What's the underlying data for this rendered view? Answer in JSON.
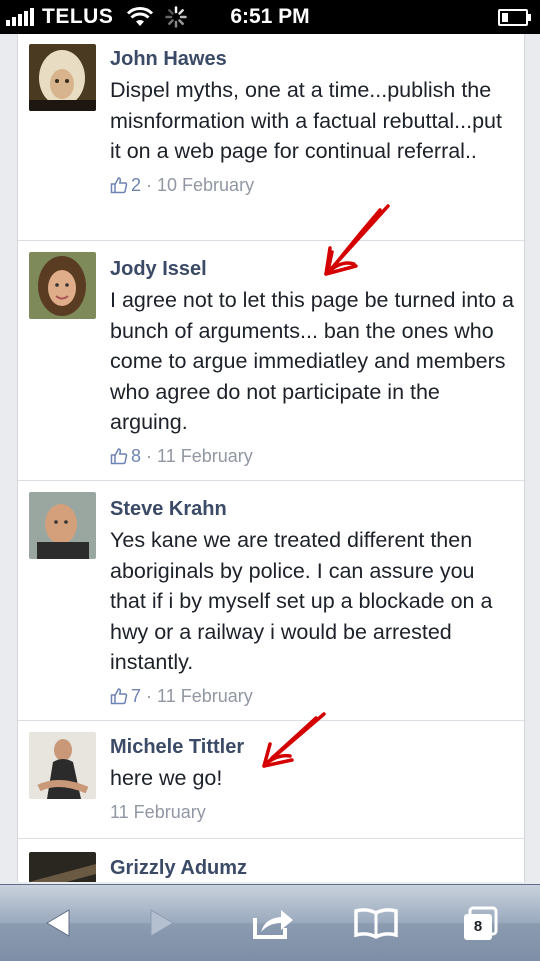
{
  "status_bar": {
    "carrier": "TELUS",
    "time": "6:51 PM"
  },
  "comments": [
    {
      "name": "John Hawes",
      "text": "Dispel myths, one at a time...publish the misnformation with a factual rebuttal...put it on a web page for continual referral..",
      "likes": "2",
      "date": "10 February"
    },
    {
      "name": "Jody Issel",
      "text": "I agree not to let this page be turned into a bunch of arguments... ban the ones who come to argue immediatley and members who agree do not participate in the arguing.",
      "likes": "8",
      "date": "11 February"
    },
    {
      "name": "Steve Krahn",
      "text": "Yes kane we are treated different then aboriginals by police. I can assure you that if i by myself set up a blockade on a hwy or a railway i would be arrested instantly.",
      "likes": "7",
      "date": "11 February"
    },
    {
      "name": "Michele Tittler",
      "text": "here we go!",
      "date": "11 February"
    },
    {
      "name": "Grizzly Adumz"
    }
  ],
  "meta_separator": "·",
  "toolbar": {
    "tabs_count": "8"
  },
  "colors": {
    "name": "#3b4a66",
    "meta": "#9197a3",
    "toolbar": "#9aa9bd",
    "annotation_arrow": "#d40000"
  },
  "icons": [
    "signal-icon",
    "wifi-icon",
    "activity-spinner-icon",
    "battery-icon",
    "like-icon",
    "back-icon",
    "forward-icon",
    "share-icon",
    "bookmarks-icon",
    "tabs-icon"
  ]
}
